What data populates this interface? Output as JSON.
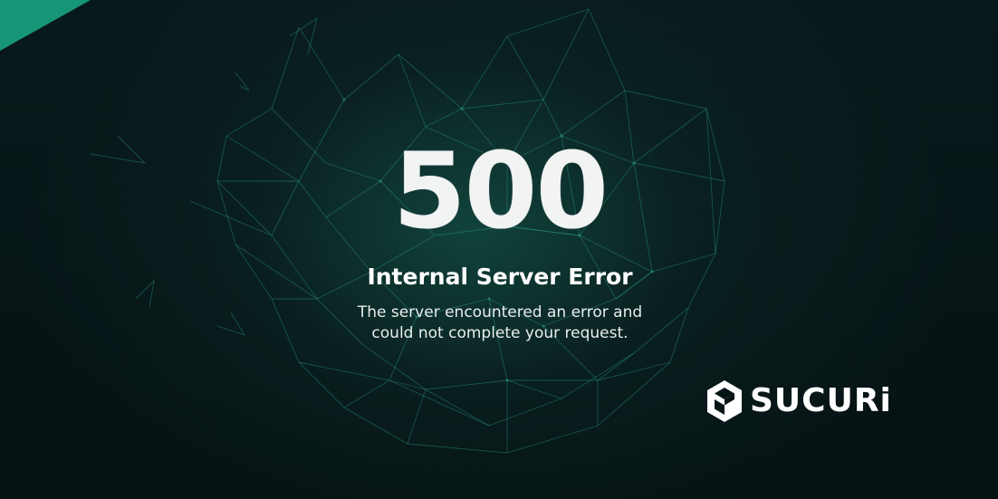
{
  "error": {
    "code": "500",
    "title": "Internal Server Error",
    "description_line1": "The server encountered an error and",
    "description_line2": "could not complete your request."
  },
  "brand": {
    "name": "SUCURi",
    "logo_icon": "sucuri-hexagon-icon",
    "accent_color": "#169676"
  },
  "background": {
    "base_color": "#071416",
    "mesh_color": "#2a9a82"
  }
}
